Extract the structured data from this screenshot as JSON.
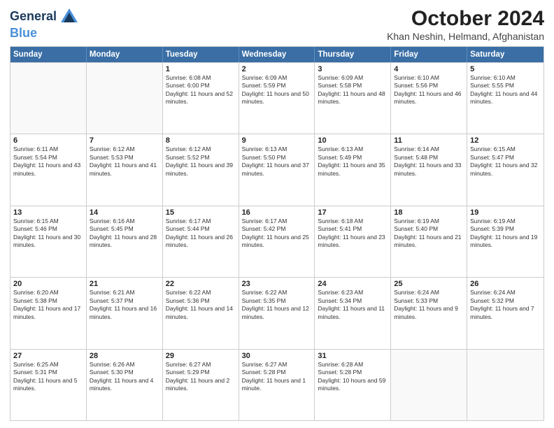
{
  "header": {
    "logo_line1": "General",
    "logo_line2": "Blue",
    "title": "October 2024",
    "subtitle": "Khan Neshin, Helmand, Afghanistan"
  },
  "calendar": {
    "days_of_week": [
      "Sunday",
      "Monday",
      "Tuesday",
      "Wednesday",
      "Thursday",
      "Friday",
      "Saturday"
    ],
    "weeks": [
      [
        {
          "day": "",
          "info": ""
        },
        {
          "day": "",
          "info": ""
        },
        {
          "day": "1",
          "info": "Sunrise: 6:08 AM\nSunset: 6:00 PM\nDaylight: 11 hours and 52 minutes."
        },
        {
          "day": "2",
          "info": "Sunrise: 6:09 AM\nSunset: 5:59 PM\nDaylight: 11 hours and 50 minutes."
        },
        {
          "day": "3",
          "info": "Sunrise: 6:09 AM\nSunset: 5:58 PM\nDaylight: 11 hours and 48 minutes."
        },
        {
          "day": "4",
          "info": "Sunrise: 6:10 AM\nSunset: 5:56 PM\nDaylight: 11 hours and 46 minutes."
        },
        {
          "day": "5",
          "info": "Sunrise: 6:10 AM\nSunset: 5:55 PM\nDaylight: 11 hours and 44 minutes."
        }
      ],
      [
        {
          "day": "6",
          "info": "Sunrise: 6:11 AM\nSunset: 5:54 PM\nDaylight: 11 hours and 43 minutes."
        },
        {
          "day": "7",
          "info": "Sunrise: 6:12 AM\nSunset: 5:53 PM\nDaylight: 11 hours and 41 minutes."
        },
        {
          "day": "8",
          "info": "Sunrise: 6:12 AM\nSunset: 5:52 PM\nDaylight: 11 hours and 39 minutes."
        },
        {
          "day": "9",
          "info": "Sunrise: 6:13 AM\nSunset: 5:50 PM\nDaylight: 11 hours and 37 minutes."
        },
        {
          "day": "10",
          "info": "Sunrise: 6:13 AM\nSunset: 5:49 PM\nDaylight: 11 hours and 35 minutes."
        },
        {
          "day": "11",
          "info": "Sunrise: 6:14 AM\nSunset: 5:48 PM\nDaylight: 11 hours and 33 minutes."
        },
        {
          "day": "12",
          "info": "Sunrise: 6:15 AM\nSunset: 5:47 PM\nDaylight: 11 hours and 32 minutes."
        }
      ],
      [
        {
          "day": "13",
          "info": "Sunrise: 6:15 AM\nSunset: 5:46 PM\nDaylight: 11 hours and 30 minutes."
        },
        {
          "day": "14",
          "info": "Sunrise: 6:16 AM\nSunset: 5:45 PM\nDaylight: 11 hours and 28 minutes."
        },
        {
          "day": "15",
          "info": "Sunrise: 6:17 AM\nSunset: 5:44 PM\nDaylight: 11 hours and 26 minutes."
        },
        {
          "day": "16",
          "info": "Sunrise: 6:17 AM\nSunset: 5:42 PM\nDaylight: 11 hours and 25 minutes."
        },
        {
          "day": "17",
          "info": "Sunrise: 6:18 AM\nSunset: 5:41 PM\nDaylight: 11 hours and 23 minutes."
        },
        {
          "day": "18",
          "info": "Sunrise: 6:19 AM\nSunset: 5:40 PM\nDaylight: 11 hours and 21 minutes."
        },
        {
          "day": "19",
          "info": "Sunrise: 6:19 AM\nSunset: 5:39 PM\nDaylight: 11 hours and 19 minutes."
        }
      ],
      [
        {
          "day": "20",
          "info": "Sunrise: 6:20 AM\nSunset: 5:38 PM\nDaylight: 11 hours and 17 minutes."
        },
        {
          "day": "21",
          "info": "Sunrise: 6:21 AM\nSunset: 5:37 PM\nDaylight: 11 hours and 16 minutes."
        },
        {
          "day": "22",
          "info": "Sunrise: 6:22 AM\nSunset: 5:36 PM\nDaylight: 11 hours and 14 minutes."
        },
        {
          "day": "23",
          "info": "Sunrise: 6:22 AM\nSunset: 5:35 PM\nDaylight: 11 hours and 12 minutes."
        },
        {
          "day": "24",
          "info": "Sunrise: 6:23 AM\nSunset: 5:34 PM\nDaylight: 11 hours and 11 minutes."
        },
        {
          "day": "25",
          "info": "Sunrise: 6:24 AM\nSunset: 5:33 PM\nDaylight: 11 hours and 9 minutes."
        },
        {
          "day": "26",
          "info": "Sunrise: 6:24 AM\nSunset: 5:32 PM\nDaylight: 11 hours and 7 minutes."
        }
      ],
      [
        {
          "day": "27",
          "info": "Sunrise: 6:25 AM\nSunset: 5:31 PM\nDaylight: 11 hours and 5 minutes."
        },
        {
          "day": "28",
          "info": "Sunrise: 6:26 AM\nSunset: 5:30 PM\nDaylight: 11 hours and 4 minutes."
        },
        {
          "day": "29",
          "info": "Sunrise: 6:27 AM\nSunset: 5:29 PM\nDaylight: 11 hours and 2 minutes."
        },
        {
          "day": "30",
          "info": "Sunrise: 6:27 AM\nSunset: 5:28 PM\nDaylight: 11 hours and 1 minute."
        },
        {
          "day": "31",
          "info": "Sunrise: 6:28 AM\nSunset: 5:28 PM\nDaylight: 10 hours and 59 minutes."
        },
        {
          "day": "",
          "info": ""
        },
        {
          "day": "",
          "info": ""
        }
      ]
    ]
  }
}
